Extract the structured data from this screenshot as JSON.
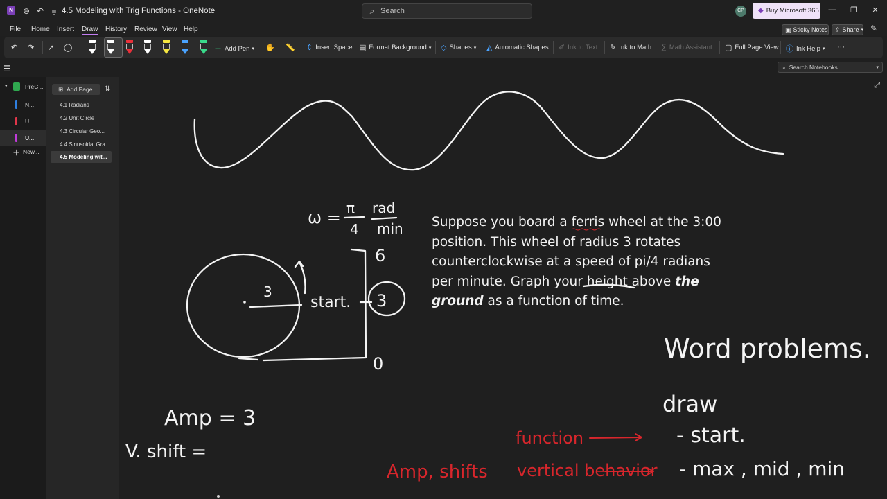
{
  "window": {
    "title": "4.5 Modeling with Trig Functions - OneNote",
    "search_placeholder": "Search",
    "avatar_initials": "CP",
    "buy_label": "Buy Microsoft 365"
  },
  "menu": {
    "items": [
      "File",
      "Home",
      "Insert",
      "Draw",
      "History",
      "Review",
      "View",
      "Help"
    ],
    "active": "Draw",
    "sticky_notes": "Sticky Notes",
    "share": "Share"
  },
  "ribbon": {
    "add_pen": "Add Pen",
    "insert_space": "Insert Space",
    "format_background": "Format Background",
    "shapes": "Shapes",
    "automatic_shapes": "Automatic Shapes",
    "ink_to_text": "Ink to Text",
    "ink_to_math": "Ink to Math",
    "math_assistant": "Math Assistant",
    "full_page_view": "Full Page View",
    "ink_help": "Ink Help",
    "pen_colors": [
      "#ffffff",
      "#ffffff",
      "#e8303a",
      "#ffffff",
      "#f5e641",
      "#4aa3ff",
      "#39d98a"
    ]
  },
  "search_notebooks": "Search Notebooks",
  "sections": [
    {
      "label": "PreC...",
      "color": "#2fa84f"
    },
    {
      "label": "N...",
      "color": "#2f7fe0"
    },
    {
      "label": "U...",
      "color": "#e0364a"
    },
    {
      "label": "U...",
      "color": "#c03bd8"
    },
    {
      "label": "New...",
      "color": ""
    }
  ],
  "pages": {
    "add_label": "Add Page",
    "items": [
      "4.1 Radians",
      "4.2 Unit Circle",
      "4.3 Circular Geo...",
      "4.4 Sinusoidal Gra...",
      "4.5 Modeling wit..."
    ]
  },
  "note": {
    "problem_part1": "Suppose you board a ferris wheel at the 3:00 position. This wheel of radius 3 rotates counterclockwise at a speed of pi/4 radians per minute. Graph your height above ",
    "problem_bold": "the ground",
    "problem_part2": " as a function of time.",
    "ink": {
      "omega": "ω = ",
      "pi": "π",
      "four": "4",
      "rad": "rad",
      "min": "min",
      "radius": "3",
      "start": "start.",
      "level_top": "6",
      "level_mid": "3",
      "level_bot": "0",
      "amp": "Amp = 3",
      "vshift": "V. shift =",
      "word_problems": "Word problems.",
      "draw": "draw",
      "bullet_start": "- start.",
      "bullet_max": "- max , mid , min",
      "red_amp": "Amp, shifts",
      "red_function": "function",
      "red_vertical": "vertical behavior"
    }
  }
}
